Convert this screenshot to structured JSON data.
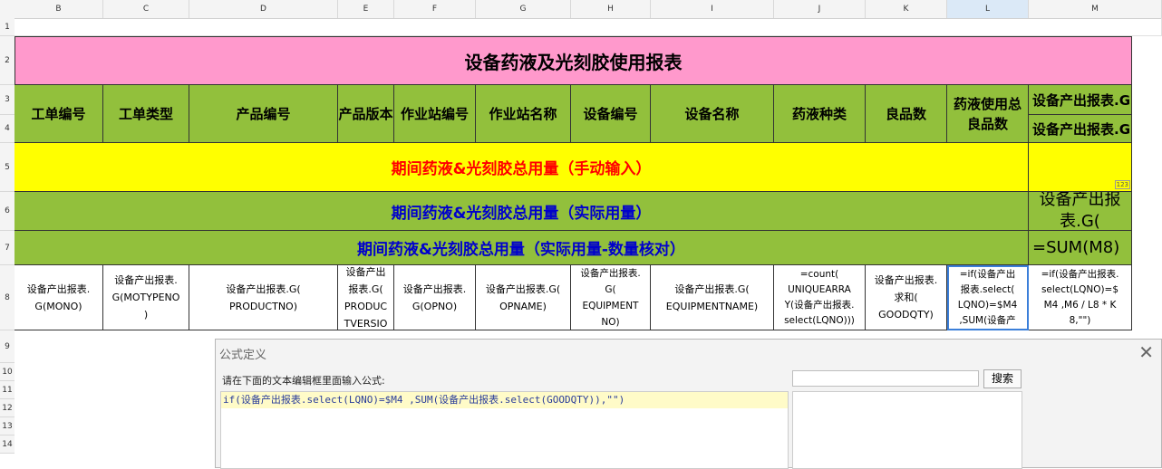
{
  "columns": [
    "B",
    "C",
    "D",
    "E",
    "F",
    "G",
    "H",
    "I",
    "J",
    "K",
    "L",
    "M"
  ],
  "rows": [
    "1",
    "2",
    "3",
    "4",
    "5",
    "6",
    "7",
    "8",
    "9",
    "10",
    "11",
    "12",
    "13",
    "14"
  ],
  "title": "设备药液及光刻胶使用报表",
  "headers": [
    "工单编号",
    "工单类型",
    "产品编号",
    "产品版本",
    "作业站编号",
    "作业站名称",
    "设备编号",
    "设备名称",
    "药液种类",
    "良品数",
    "药液使用总良品数"
  ],
  "m3": "设备产出报表.G(",
  "m4": "设备产出报表.G(LQNO)",
  "row5": "期间药液&光刻胶总用量（手动输入）",
  "row6": "期间药液&光刻胶总用量（实际用量）",
  "row7": "期间药液&光刻胶总用量（实际用量-数量核对）",
  "m6": "设备产出报表.G(",
  "m7": "=SUM(M8)",
  "row8": [
    "设备产出报表.\nG(MONO)",
    "设备产出报表.\nG(MOTYPENO\n)",
    "设备产出报表.G(\nPRODUCTNO)",
    "设备产出\n报表.G(\nPRODUC\nTVERSIO",
    "设备产出报表.\nG(OPNO)",
    "设备产出报表.G(\nOPNAME)",
    "设备产出报表.\nG(\nEQUIPMENT\nNO)",
    "设备产出报表.G(\nEQUIPMENTNAME)",
    "=count(\nUNIQUEARRA\nY(设备产出报表.\nselect(LQNO)))",
    "设备产出报表.\n求和(\nGOODQTY)",
    "=if(设备产出\n报表.select(\nLQNO)=$M4\n,SUM(设备产",
    "=if(设备产出报表.\nselect(LQNO)=$\nM4 ,M6 / L8 * K\n8,\"\")"
  ],
  "m5_badge": "123",
  "dialog": {
    "title": "公式定义",
    "prompt": "请在下面的文本编辑框里面输入公式:",
    "formula": "if(设备产出报表.select(LQNO)=$M4 ,SUM(设备产出报表.select(GOODQTY)),\"\")",
    "search_label": "搜索",
    "search_value": ""
  },
  "colors": {
    "title_bg": "#ff99cc",
    "header_bg": "#92c03c",
    "yellow": "#ffff00",
    "red": "#ff0000",
    "blue": "#0000cc"
  }
}
